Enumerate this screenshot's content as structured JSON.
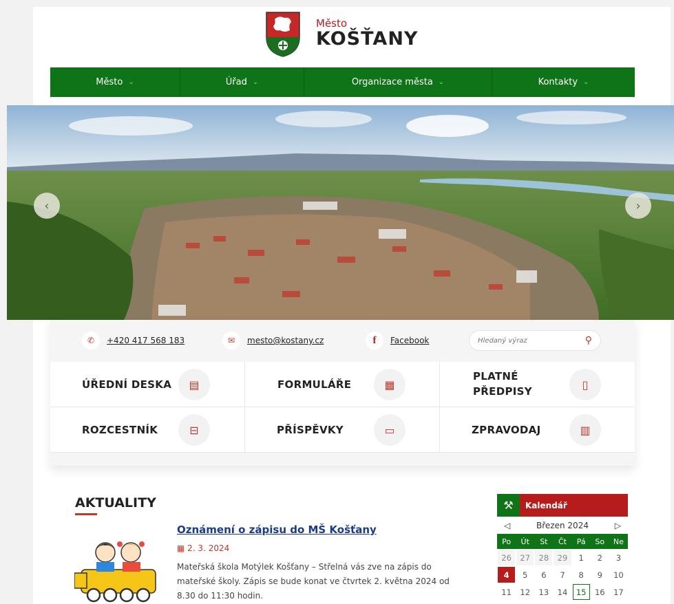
{
  "header": {
    "logo_small": "Město",
    "logo_big": "KOŠŤANY"
  },
  "nav": {
    "items": [
      {
        "label": "Město"
      },
      {
        "label": "Úřad"
      },
      {
        "label": "Organizace města"
      },
      {
        "label": "Kontakty"
      }
    ]
  },
  "hero": {
    "prev_icon": "chevron-left-icon",
    "next_icon": "chevron-right-icon"
  },
  "contact": {
    "phone": "+420 417 568 183",
    "email": "mesto@kostany.cz",
    "facebook": "Facebook",
    "search_placeholder": "Hledaný výraz"
  },
  "tiles": [
    {
      "label": "ÚŘEDNÍ DESKA",
      "icon": "board-icon"
    },
    {
      "label": "FORMULÁŘE",
      "icon": "document-icon"
    },
    {
      "label": "PLATNÉ PŘEDPISY",
      "icon": "regulation-icon"
    },
    {
      "label": "ROZCESTNÍK",
      "icon": "signpost-icon"
    },
    {
      "label": "PŘÍSPĚVKY",
      "icon": "money-icon"
    },
    {
      "label": "ZPRAVODAJ",
      "icon": "newspaper-icon"
    }
  ],
  "news": {
    "section_title": "AKTUALITY",
    "items": [
      {
        "title": "Oznámení o zápisu do MŠ Košťany",
        "date": "2. 3. 2024",
        "text": "Mateřská škola Motýlek Košťany – Střelná vás zve na zápis do mateřské školy. Zápis se bude konat ve čtvrtek 2. května 2024 od 8.30 do 11:30 hodin."
      }
    ]
  },
  "calendar": {
    "title": "Kalendář",
    "month": "Březen 2024",
    "prev": "◁",
    "next": "▷",
    "weekdays": [
      "Po",
      "Út",
      "St",
      "Čt",
      "Pá",
      "So",
      "Ne"
    ],
    "rows": [
      [
        "26",
        "27",
        "28",
        "29",
        "1",
        "2",
        "3"
      ],
      [
        "4",
        "5",
        "6",
        "7",
        "8",
        "9",
        "10"
      ],
      [
        "11",
        "12",
        "13",
        "14",
        "15",
        "16",
        "17"
      ]
    ],
    "today": "4",
    "event_day": "15",
    "colors": {
      "green": "#0f7317",
      "red": "#b71c1c"
    }
  }
}
